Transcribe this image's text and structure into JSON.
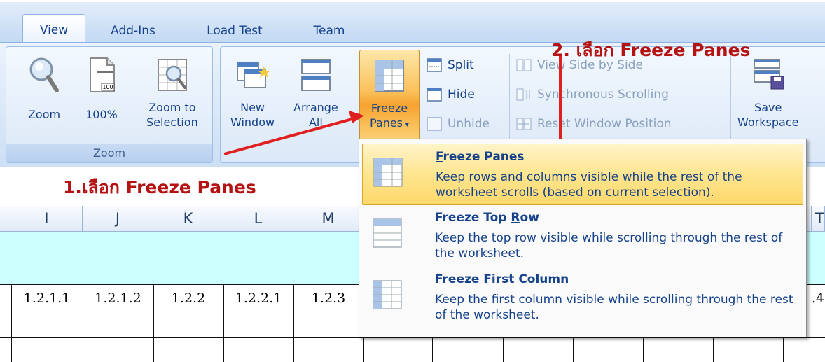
{
  "tabs": [
    {
      "label": "View",
      "active": true
    },
    {
      "label": "Add-Ins"
    },
    {
      "label": "Load Test"
    },
    {
      "label": "Team"
    }
  ],
  "ribbon": {
    "zoom_group": {
      "label": "Zoom",
      "zoom": "Zoom",
      "hundred": "100%",
      "zoom_sel_1": "Zoom to",
      "zoom_sel_2": "Selection"
    },
    "window_group": {
      "new_window_1": "New",
      "new_window_2": "Window",
      "arrange_1": "Arrange",
      "arrange_2": "All",
      "freeze_1": "Freeze",
      "freeze_2": "Panes",
      "split": "Split",
      "hide": "Hide",
      "unhide": "Unhide",
      "view_side": "View Side by Side",
      "sync_scroll": "Synchronous Scrolling",
      "reset_pos": "Reset Window Position",
      "save_ws_1": "Save",
      "save_ws_2": "Workspace"
    }
  },
  "annotations": {
    "step1": "1.เลือก   Freeze Panes",
    "step2": "2. เลือก   Freeze Panes"
  },
  "sheet": {
    "columns": [
      "I",
      "J",
      "K",
      "L",
      "M"
    ],
    "partial_right_col": "T",
    "row_values": [
      "1.2.1.1",
      "1.2.1.2",
      "1.2.2",
      "1.2.2.1",
      "1.2.3"
    ],
    "partial_right_value": ".4"
  },
  "dropdown": {
    "items": [
      {
        "title_pre": "",
        "title_ul": "F",
        "title_post": "reeze Panes",
        "desc": "Keep rows and columns visible while the rest of the worksheet scrolls (based on current selection).",
        "highlighted": true
      },
      {
        "title_pre": "Freeze Top ",
        "title_ul": "R",
        "title_post": "ow",
        "desc": "Keep the top row visible while scrolling through the rest of the worksheet."
      },
      {
        "title_pre": "Freeze First ",
        "title_ul": "C",
        "title_post": "olumn",
        "desc": "Keep the first column visible while scrolling through the rest of the worksheet."
      }
    ]
  },
  "colors": {
    "ribbon_text": "#15428b",
    "annotation": "#b51212",
    "highlight": "#ffe58f",
    "cyan_row": "#ccffff"
  }
}
